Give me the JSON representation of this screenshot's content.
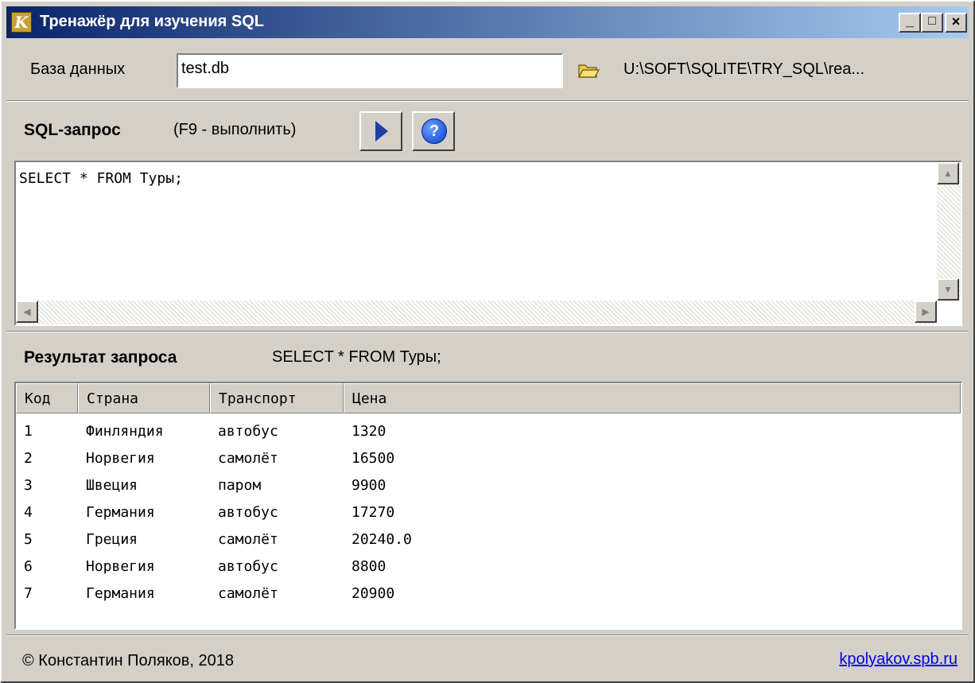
{
  "window": {
    "title": "Тренажёр для изучения SQL",
    "icon_letter": "K",
    "controls": {
      "minimize": "_",
      "maximize": "□",
      "close": "×"
    }
  },
  "database": {
    "label": "База данных",
    "value": "test.db",
    "path": "U:\\SOFT\\SQLITE\\TRY_SQL\\rea..."
  },
  "sql": {
    "title": "SQL-запрос",
    "hint": "(F9 - выполнить)",
    "help_glyph": "?",
    "text": "SELECT * FROM Туры;"
  },
  "result": {
    "title": "Результат запроса",
    "query": "SELECT * FROM Туры;",
    "columns": [
      "Код",
      "Страна",
      "Транспорт",
      "Цена"
    ],
    "rows": [
      [
        "1",
        "Финляндия",
        "автобус",
        "1320"
      ],
      [
        "2",
        "Норвегия",
        "самолёт",
        "16500"
      ],
      [
        "3",
        "Швеция",
        "паром",
        "9900"
      ],
      [
        "4",
        "Германия",
        "автобус",
        "17270"
      ],
      [
        "5",
        "Греция",
        "самолёт",
        "20240.0"
      ],
      [
        "6",
        "Норвегия",
        "автобус",
        "8800"
      ],
      [
        "7",
        "Германия",
        "самолёт",
        "20900"
      ]
    ]
  },
  "footer": {
    "copyright": "© Константин Поляков, 2018",
    "link": "kpolyakov.spb.ru"
  }
}
